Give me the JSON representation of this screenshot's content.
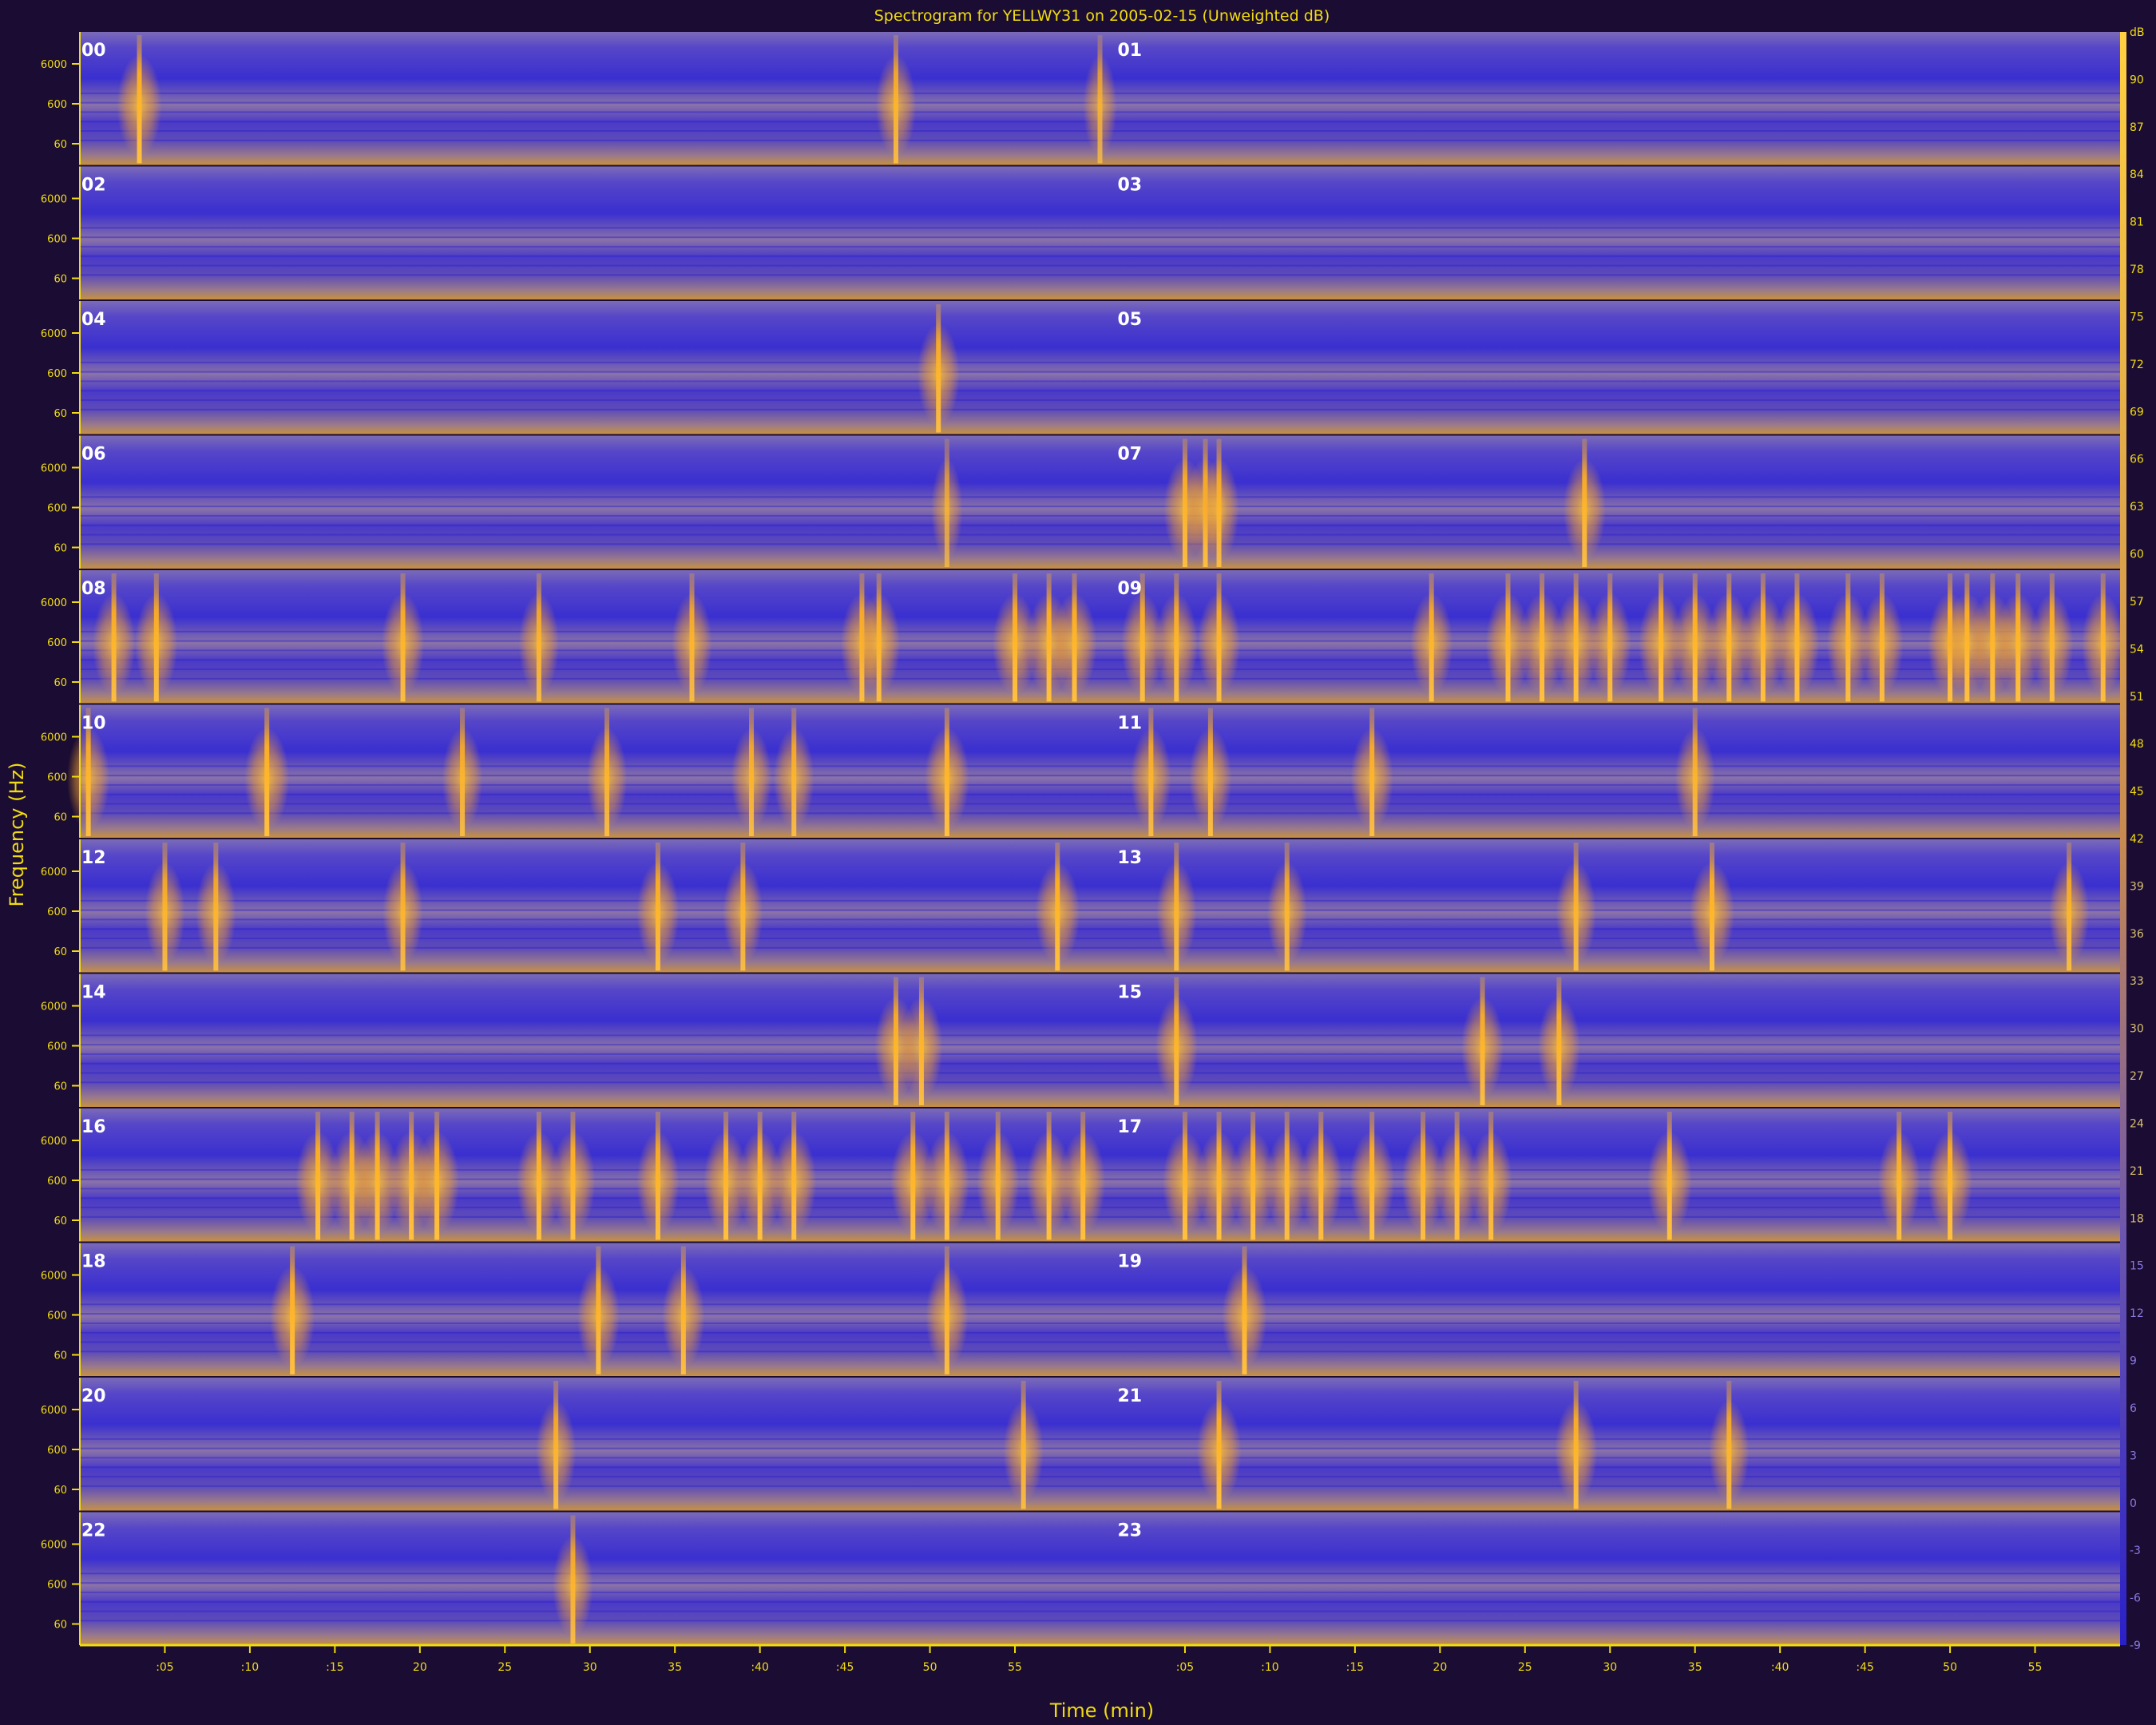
{
  "chart_data": {
    "type": "heatmap",
    "title": "Spectrogram for YELLWY31 on 2005-02-15 (Unweighted dB)",
    "xlabel": "Time (min)",
    "ylabel": "Frequency (Hz)",
    "grid": false,
    "x_ticks": [
      ":05",
      ":10",
      ":15",
      "20",
      "25",
      "30",
      "35",
      ":40",
      ":45",
      "50",
      "55"
    ],
    "y_ticks": [
      "6000",
      "600",
      "60"
    ],
    "hour_labels": [
      "00",
      "01",
      "02",
      "03",
      "04",
      "05",
      "06",
      "07",
      "08",
      "09",
      "10",
      "11",
      "12",
      "13",
      "14",
      "15",
      "16",
      "17",
      "18",
      "19",
      "20",
      "21",
      "22",
      "23"
    ],
    "colorbar_ticks": [
      "dB",
      "90",
      "87",
      "84",
      "81",
      "78",
      "75",
      "72",
      "69",
      "66",
      "63",
      "60",
      "57",
      "54",
      "51",
      "48",
      "45",
      "42",
      "39",
      "36",
      "33",
      "30",
      "27",
      "24",
      "21",
      "18",
      "15",
      "12",
      "9",
      "6",
      "3",
      "0",
      "-3",
      "-6",
      "-9"
    ],
    "colors": {
      "background": "#1b0c33",
      "low": "#3a2fd0",
      "mid": "#8a72a8",
      "high": "#ffb020",
      "axis": "#f0dc10",
      "title": "#f0dc10",
      "hour_label": "#ffffff"
    },
    "events": [
      {
        "hour": "00",
        "minute": 3.5,
        "strength": 1.0
      },
      {
        "hour": "00",
        "minute": 48,
        "strength": 0.8
      },
      {
        "hour": "01",
        "minute": 0,
        "strength": 0.5
      },
      {
        "hour": "04",
        "minute": 50.5,
        "strength": 0.9
      },
      {
        "hour": "06",
        "minute": 51,
        "strength": 0.4
      },
      {
        "hour": "07",
        "minute": 5,
        "strength": 0.9
      },
      {
        "hour": "07",
        "minute": 6.2,
        "strength": 0.9
      },
      {
        "hour": "07",
        "minute": 7,
        "strength": 0.8
      },
      {
        "hour": "07",
        "minute": 28.5,
        "strength": 0.9
      },
      {
        "hour": "08",
        "minute": 2,
        "strength": 0.9
      },
      {
        "hour": "08",
        "minute": 4.5,
        "strength": 0.9
      },
      {
        "hour": "08",
        "minute": 19,
        "strength": 0.9
      },
      {
        "hour": "08",
        "minute": 27,
        "strength": 0.8
      },
      {
        "hour": "08",
        "minute": 36,
        "strength": 0.8
      },
      {
        "hour": "08",
        "minute": 46,
        "strength": 0.9
      },
      {
        "hour": "08",
        "minute": 47,
        "strength": 0.9
      },
      {
        "hour": "08",
        "minute": 55,
        "strength": 1.0
      },
      {
        "hour": "08",
        "minute": 57,
        "strength": 1.0
      },
      {
        "hour": "08",
        "minute": 58.5,
        "strength": 1.0
      },
      {
        "hour": "09",
        "minute": 2.5,
        "strength": 0.9
      },
      {
        "hour": "09",
        "minute": 4.5,
        "strength": 0.9
      },
      {
        "hour": "09",
        "minute": 7,
        "strength": 0.9
      },
      {
        "hour": "09",
        "minute": 19.5,
        "strength": 0.9
      },
      {
        "hour": "09",
        "minute": 24,
        "strength": 1.0
      },
      {
        "hour": "09",
        "minute": 26,
        "strength": 1.0
      },
      {
        "hour": "09",
        "minute": 28,
        "strength": 1.0
      },
      {
        "hour": "09",
        "minute": 30,
        "strength": 0.9
      },
      {
        "hour": "09",
        "minute": 33,
        "strength": 1.0
      },
      {
        "hour": "09",
        "minute": 35,
        "strength": 1.0
      },
      {
        "hour": "09",
        "minute": 37,
        "strength": 1.0
      },
      {
        "hour": "09",
        "minute": 39,
        "strength": 1.0
      },
      {
        "hour": "09",
        "minute": 41,
        "strength": 1.0
      },
      {
        "hour": "09",
        "minute": 44,
        "strength": 0.9
      },
      {
        "hour": "09",
        "minute": 46,
        "strength": 0.9
      },
      {
        "hour": "09",
        "minute": 50,
        "strength": 1.0
      },
      {
        "hour": "09",
        "minute": 51,
        "strength": 1.0
      },
      {
        "hour": "09",
        "minute": 52.5,
        "strength": 1.0
      },
      {
        "hour": "09",
        "minute": 54,
        "strength": 1.0
      },
      {
        "hour": "09",
        "minute": 56,
        "strength": 0.9
      },
      {
        "hour": "09",
        "minute": 59,
        "strength": 0.9
      },
      {
        "hour": "10",
        "minute": 0.5,
        "strength": 0.9
      },
      {
        "hour": "10",
        "minute": 11,
        "strength": 1.0
      },
      {
        "hour": "10",
        "minute": 22.5,
        "strength": 0.8
      },
      {
        "hour": "10",
        "minute": 31,
        "strength": 0.8
      },
      {
        "hour": "10",
        "minute": 39.5,
        "strength": 0.8
      },
      {
        "hour": "10",
        "minute": 42,
        "strength": 0.8
      },
      {
        "hour": "10",
        "minute": 51,
        "strength": 1.0
      },
      {
        "hour": "11",
        "minute": 3,
        "strength": 0.8
      },
      {
        "hour": "11",
        "minute": 6.5,
        "strength": 0.9
      },
      {
        "hour": "11",
        "minute": 16,
        "strength": 0.9
      },
      {
        "hour": "11",
        "minute": 35,
        "strength": 0.8
      },
      {
        "hour": "12",
        "minute": 5,
        "strength": 0.8
      },
      {
        "hour": "12",
        "minute": 8,
        "strength": 0.8
      },
      {
        "hour": "12",
        "minute": 19,
        "strength": 0.8
      },
      {
        "hour": "12",
        "minute": 34,
        "strength": 0.9
      },
      {
        "hour": "12",
        "minute": 39,
        "strength": 0.8
      },
      {
        "hour": "12",
        "minute": 57.5,
        "strength": 1.0
      },
      {
        "hour": "13",
        "minute": 4.5,
        "strength": 0.8
      },
      {
        "hour": "13",
        "minute": 11,
        "strength": 0.8
      },
      {
        "hour": "13",
        "minute": 28,
        "strength": 0.8
      },
      {
        "hour": "13",
        "minute": 36,
        "strength": 1.0
      },
      {
        "hour": "13",
        "minute": 57,
        "strength": 0.8
      },
      {
        "hour": "14",
        "minute": 48,
        "strength": 0.9
      },
      {
        "hour": "14",
        "minute": 49.5,
        "strength": 0.9
      },
      {
        "hour": "15",
        "minute": 4.5,
        "strength": 0.9
      },
      {
        "hour": "15",
        "minute": 22.5,
        "strength": 0.9
      },
      {
        "hour": "15",
        "minute": 27,
        "strength": 0.9
      },
      {
        "hour": "16",
        "minute": 14,
        "strength": 1.0
      },
      {
        "hour": "16",
        "minute": 16,
        "strength": 1.0
      },
      {
        "hour": "16",
        "minute": 17.5,
        "strength": 1.0
      },
      {
        "hour": "16",
        "minute": 19.5,
        "strength": 1.0
      },
      {
        "hour": "16",
        "minute": 21,
        "strength": 1.0
      },
      {
        "hour": "16",
        "minute": 27,
        "strength": 1.0
      },
      {
        "hour": "16",
        "minute": 29,
        "strength": 1.0
      },
      {
        "hour": "16",
        "minute": 34,
        "strength": 0.9
      },
      {
        "hour": "16",
        "minute": 38,
        "strength": 1.0
      },
      {
        "hour": "16",
        "minute": 40,
        "strength": 1.0
      },
      {
        "hour": "16",
        "minute": 42,
        "strength": 1.0
      },
      {
        "hour": "16",
        "minute": 49,
        "strength": 1.0
      },
      {
        "hour": "16",
        "minute": 51,
        "strength": 1.0
      },
      {
        "hour": "16",
        "minute": 54,
        "strength": 0.9
      },
      {
        "hour": "16",
        "minute": 57,
        "strength": 1.0
      },
      {
        "hour": "16",
        "minute": 59,
        "strength": 1.0
      },
      {
        "hour": "17",
        "minute": 5,
        "strength": 1.0
      },
      {
        "hour": "17",
        "minute": 7,
        "strength": 1.0
      },
      {
        "hour": "17",
        "minute": 9,
        "strength": 1.0
      },
      {
        "hour": "17",
        "minute": 11,
        "strength": 0.9
      },
      {
        "hour": "17",
        "minute": 13,
        "strength": 0.9
      },
      {
        "hour": "17",
        "minute": 16,
        "strength": 1.0
      },
      {
        "hour": "17",
        "minute": 19,
        "strength": 0.9
      },
      {
        "hour": "17",
        "minute": 21,
        "strength": 0.9
      },
      {
        "hour": "17",
        "minute": 23,
        "strength": 0.9
      },
      {
        "hour": "17",
        "minute": 33.5,
        "strength": 1.0
      },
      {
        "hour": "17",
        "minute": 47,
        "strength": 0.9
      },
      {
        "hour": "17",
        "minute": 50,
        "strength": 1.0
      },
      {
        "hour": "18",
        "minute": 12.5,
        "strength": 1.0
      },
      {
        "hour": "18",
        "minute": 30.5,
        "strength": 0.9
      },
      {
        "hour": "18",
        "minute": 35.5,
        "strength": 0.9
      },
      {
        "hour": "18",
        "minute": 51,
        "strength": 0.9
      },
      {
        "hour": "19",
        "minute": 8.5,
        "strength": 1.0
      },
      {
        "hour": "20",
        "minute": 28,
        "strength": 0.8
      },
      {
        "hour": "20",
        "minute": 55.5,
        "strength": 0.8
      },
      {
        "hour": "21",
        "minute": 7,
        "strength": 1.0
      },
      {
        "hour": "21",
        "minute": 28,
        "strength": 0.9
      },
      {
        "hour": "21",
        "minute": 37,
        "strength": 0.8
      },
      {
        "hour": "22",
        "minute": 29,
        "strength": 0.8
      }
    ]
  }
}
